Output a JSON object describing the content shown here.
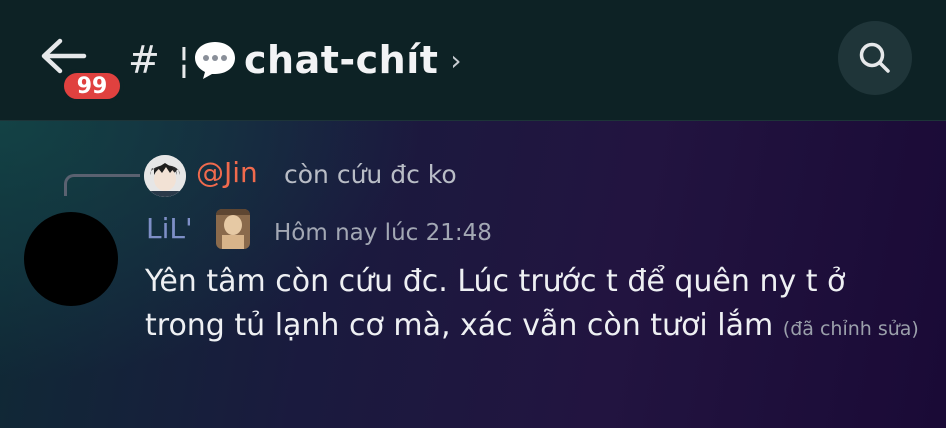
{
  "header": {
    "unread_badge": "99",
    "channel_hash": "#",
    "channel_prefix": "¦",
    "channel_name": "chat-chít",
    "channel_chevron": "›",
    "icons": [
      "back-arrow-icon",
      "speech-bubble-icon",
      "search-icon"
    ]
  },
  "reply": {
    "mention": "@Jin",
    "text": "còn cứu đc ko"
  },
  "message": {
    "author": "LiL'",
    "timestamp": "Hôm nay lúc 21:48",
    "body": "Yên tâm còn cứu đc. Lúc trước t để quên ny t ở trong tủ lạnh cơ mà, xác vẫn còn tươi lắm",
    "edited": "(đã chỉnh sửa)"
  },
  "colors": {
    "header_bg": "#0d2225",
    "badge": "#e0413f",
    "mention": "#f06a4d",
    "author": "#7e8fc7"
  }
}
